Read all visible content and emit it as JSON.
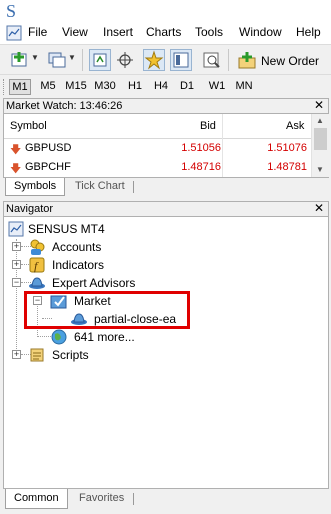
{
  "app": {
    "logo_letter": "S"
  },
  "menu": [
    {
      "label": "File"
    },
    {
      "label": "View"
    },
    {
      "label": "Insert"
    },
    {
      "label": "Charts"
    },
    {
      "label": "Tools"
    },
    {
      "label": "Window"
    },
    {
      "label": "Help"
    }
  ],
  "toolbar": {
    "new_order_label": "New Order"
  },
  "timeframes": [
    "M1",
    "M5",
    "M15",
    "M30",
    "H1",
    "H4",
    "D1",
    "W1",
    "MN"
  ],
  "market_watch": {
    "title": "Market Watch: 13:46:26",
    "columns": {
      "symbol": "Symbol",
      "bid": "Bid",
      "ask": "Ask"
    },
    "rows": [
      {
        "symbol": "GBPUSD",
        "bid": "1.51056",
        "ask": "1.51076"
      },
      {
        "symbol": "GBPCHF",
        "bid": "1.48716",
        "ask": "1.48781"
      }
    ],
    "tabs": [
      "Symbols",
      "Tick Chart"
    ]
  },
  "navigator": {
    "title": "Navigator",
    "tree": {
      "root": "SENSUS MT4",
      "accounts": "Accounts",
      "indicators": "Indicators",
      "expert_advisors": "Expert Advisors",
      "market": "Market",
      "ea_item": "partial-close-ea",
      "more": "641 more...",
      "scripts": "Scripts"
    },
    "tabs": [
      "Common",
      "Favorites"
    ]
  },
  "colors": {
    "price_down": "#d40000",
    "highlight": "#e00000",
    "accent": "#3c6fb0"
  }
}
